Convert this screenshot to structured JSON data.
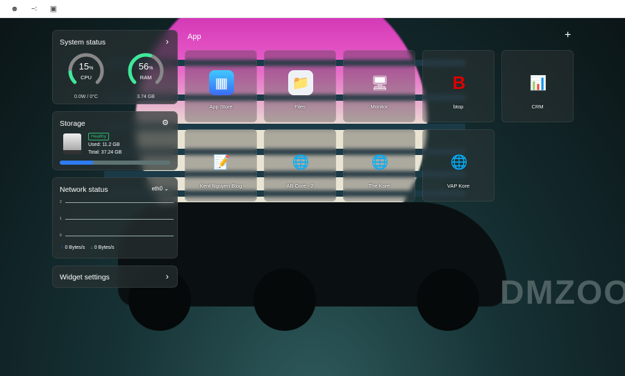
{
  "topbar": {
    "icons": [
      "user-icon",
      "sliders-icon",
      "display-icon"
    ]
  },
  "system_status": {
    "title": "System status",
    "cpu": {
      "percent": 15,
      "label": "CPU",
      "sub": "0.0W / 0°C"
    },
    "ram": {
      "percent": 56,
      "label": "RAM",
      "sub": "3.74 GB"
    },
    "unit": "%"
  },
  "storage": {
    "title": "Storage",
    "badge": "Healthy",
    "used": "Used: 11.2 GB",
    "total": "Total: 37.24 GB",
    "used_fraction": 0.3
  },
  "network": {
    "title": "Network status",
    "interface": "eth0",
    "y_ticks": [
      "2",
      "1",
      "0"
    ],
    "upload": "0 Bytes/s",
    "download": "0 Bytes/s"
  },
  "widget_settings": {
    "title": "Widget settings"
  },
  "apps": {
    "title": "App",
    "items": [
      {
        "label": "App Store"
      },
      {
        "label": "Files"
      },
      {
        "label": "Monitor"
      },
      {
        "label": "btop"
      },
      {
        "label": "CRM"
      },
      {
        "label": "Kent Nguyen Blog"
      },
      {
        "label": "AB Core - 2"
      },
      {
        "label": "The Kore"
      },
      {
        "label": "VAP Kore"
      }
    ]
  },
  "watermark": "DMZOO",
  "colors": {
    "accent_green": "#3ee89a",
    "progress_blue": "#2f7bf0",
    "healthy": "#2fbf71"
  }
}
